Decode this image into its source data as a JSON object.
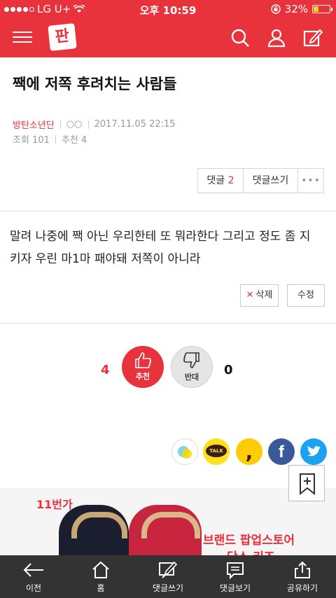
{
  "status_bar": {
    "carrier": "LG U+",
    "time": "오후 10:59",
    "battery_percent": "32%",
    "battery_level": 0.32
  },
  "nav": {
    "logo_text": "판"
  },
  "post": {
    "title": "짹에 저쪽 후려치는 사람들",
    "author": "방탄소년단",
    "author_mark": "○○",
    "date": "2017.11.05 22:15",
    "views": "조회 101",
    "recommends": "추천 4",
    "body_line1": "말려 나중에 짹 아닌 우리한테 또 뭐라한다 그리고 정도 좀 지",
    "body_line2": "키자 우린 마1마 패야돼 저쪽이 아니라"
  },
  "actions": {
    "comment_label": "댓글",
    "comment_count": "2",
    "write_comment_label": "댓글쓰기",
    "more_label": "•••",
    "delete_label": "삭제",
    "edit_label": "수정"
  },
  "votes": {
    "up_count": "4",
    "up_label": "추천",
    "down_count": "0",
    "down_label": "반대"
  },
  "share": {
    "kakaotalk_label": "TALK",
    "facebook_label": "f"
  },
  "ad": {
    "brand": "11번가",
    "line1": "브랜드 팝업스토어",
    "line2": "닥스 키즈"
  },
  "toolbar": {
    "back": "이전",
    "home": "홈",
    "write": "댓글쓰기",
    "view": "댓글보기",
    "share": "공유하기"
  },
  "colors": {
    "brand_red": "#e8323c",
    "toolbar_bg": "#333333",
    "facebook": "#3b5998",
    "twitter": "#1da1f2",
    "kakao_yellow": "#ffe01b"
  }
}
